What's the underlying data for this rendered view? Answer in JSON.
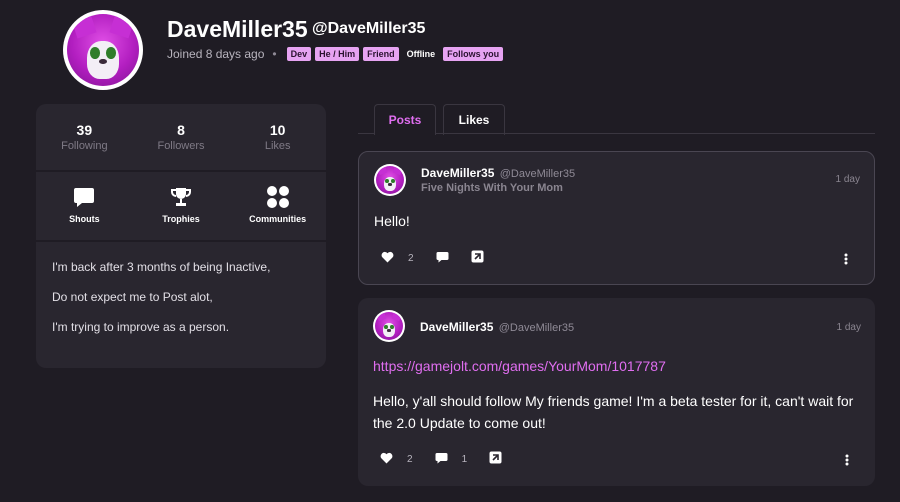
{
  "profile": {
    "display_name": "DaveMiller35",
    "username": "@DaveMiller35",
    "joined": "Joined 8 days ago",
    "tags": [
      "Dev",
      "He / Him",
      "Friend"
    ],
    "status_offline": "Offline",
    "follows_you": "Follows you"
  },
  "stats": [
    {
      "value": "39",
      "label": "Following"
    },
    {
      "value": "8",
      "label": "Followers"
    },
    {
      "value": "10",
      "label": "Likes"
    }
  ],
  "quick_links": [
    {
      "label": "Shouts",
      "icon": "speech-bubble-icon"
    },
    {
      "label": "Trophies",
      "icon": "trophy-icon"
    },
    {
      "label": "Communities",
      "icon": "communities-icon"
    }
  ],
  "bio": [
    "I'm back after 3 months of being Inactive,",
    "Do not expect me to Post alot,",
    "I'm trying to improve as a person."
  ],
  "tabs": {
    "posts": "Posts",
    "likes": "Likes"
  },
  "posts": [
    {
      "author": "DaveMiller35",
      "handle": "@DaveMiller35",
      "game": "Five Nights With Your Mom",
      "time": "1 day",
      "text": "Hello!",
      "likes": "2",
      "comments": ""
    },
    {
      "author": "DaveMiller35",
      "handle": "@DaveMiller35",
      "time": "1 day",
      "link": "https://gamejolt.com/games/YourMom/1017787",
      "text": "Hello, y'all should follow My friends game! I'm a beta tester for it, can't wait for the 2.0 Update to come out!",
      "likes": "2",
      "comments": "1"
    }
  ],
  "colors": {
    "background": "#1f1c24",
    "card": "#29262f",
    "accent": "#e06ef0",
    "tag": "#e6a3f2"
  }
}
